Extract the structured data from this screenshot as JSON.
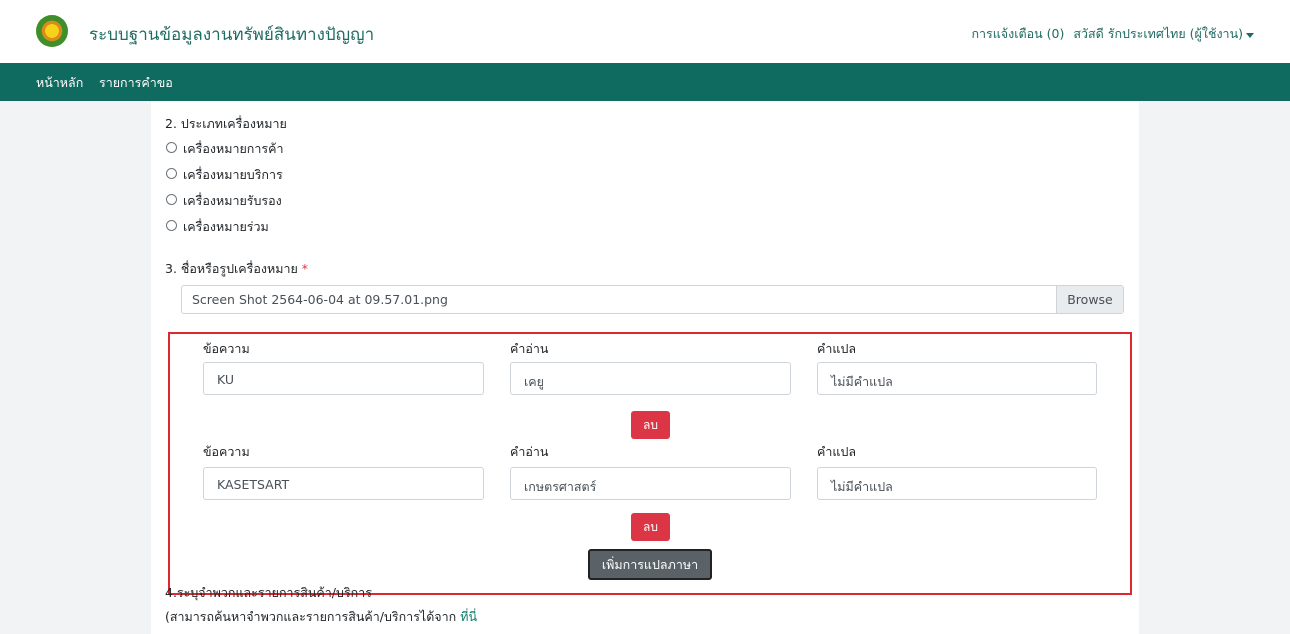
{
  "header": {
    "app_title": "ระบบฐานข้อมูลงานทรัพย์สินทางปัญญา",
    "notifications": "การแจ้งเตือน (0)",
    "user_greeting": "สวัสดี รักประเทศไทย (ผู้ใช้งาน)"
  },
  "nav": {
    "home": "หน้าหลัก",
    "requests": "รายการคำขอ"
  },
  "form": {
    "section2_title": "2. ประเภทเครื่องหมาย",
    "mark_types": [
      "เครื่องหมายการค้า",
      "เครื่องหมายบริการ",
      "เครื่องหมายรับรอง",
      "เครื่องหมายร่วม"
    ],
    "section3_title": "3. ชื่อหรือรูปเครื่องหมาย",
    "required_mark": "*",
    "file_name": "Screen Shot 2564-06-04 at 09.57.01.png",
    "browse_label": "Browse",
    "translations": [
      {
        "text_label": "ข้อความ",
        "reading_label": "คำอ่าน",
        "meaning_label": "คำแปล",
        "text": "KU",
        "reading": "เคยู",
        "meaning": "ไม่มีคำแปล",
        "delete_label": "ลบ"
      },
      {
        "text_label": "ข้อความ",
        "reading_label": "คำอ่าน",
        "meaning_label": "คำแปล",
        "text": "KASETSART",
        "reading": "เกษตรศาสตร์",
        "meaning": "ไม่มีคำแปล",
        "delete_label": "ลบ"
      }
    ],
    "add_translation_label": "เพิ่มการแปลภาษา",
    "section4_title": "4.ระบุจำพวกและรายการสินค้า/บริการ",
    "section4_hint": "(สามารถค้นหาจำพวกและรายการสินค้า/บริการได้จาก",
    "section4_link": "ที่นี่"
  },
  "colors": {
    "navbar": "#0f6a5f",
    "title_text": "#1f6b63",
    "delete_button": "#dc3545",
    "highlight_border": "#e0272f",
    "add_button": "#5a6268"
  }
}
